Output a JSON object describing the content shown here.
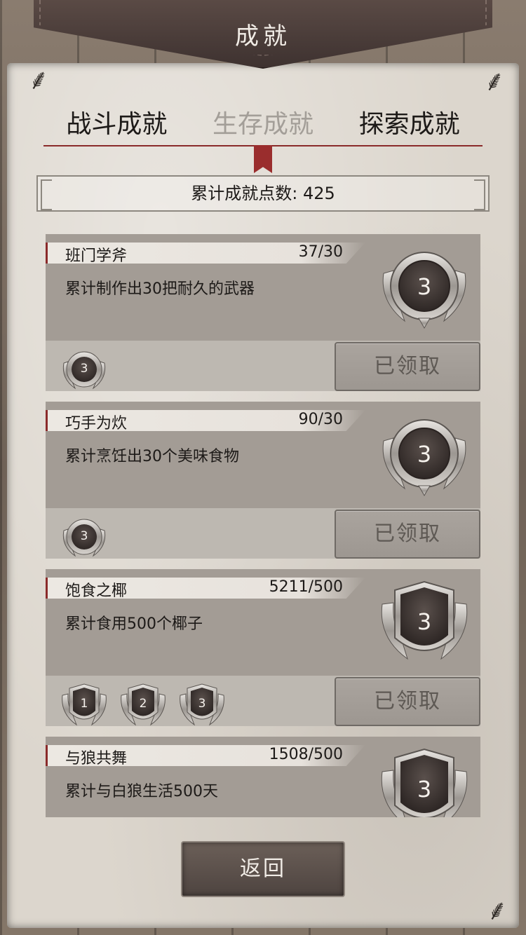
{
  "header": {
    "title": "成就"
  },
  "tabs": [
    {
      "label": "战斗成就",
      "active": false
    },
    {
      "label": "生存成就",
      "active": true
    },
    {
      "label": "探索成就",
      "active": false
    }
  ],
  "points": {
    "label": "累计成就点数: 425"
  },
  "achievements": [
    {
      "name": "班门学斧",
      "progress": "37/30",
      "desc": "累计制作出30把耐久的武器",
      "medal": "3",
      "medal_style": "round",
      "small_medals": [
        "3"
      ],
      "button": "已领取"
    },
    {
      "name": "巧手为炊",
      "progress": "90/30",
      "desc": "累计烹饪出30个美味食物",
      "medal": "3",
      "medal_style": "round",
      "small_medals": [
        "3"
      ],
      "button": "已领取"
    },
    {
      "name": "饱食之椰",
      "progress": "5211/500",
      "desc": "累计食用500个椰子",
      "medal": "3",
      "medal_style": "shield",
      "small_medals": [
        "1",
        "2",
        "3"
      ],
      "button": "已领取"
    },
    {
      "name": "与狼共舞",
      "progress": "1508/500",
      "desc": "累计与白狼生活500天",
      "medal": "3",
      "medal_style": "shield"
    }
  ],
  "footer": {
    "back_label": "返回"
  },
  "colors": {
    "accent": "#8a2a2a",
    "parchment": "#dcd6cd",
    "banner": "#4a3c39"
  }
}
